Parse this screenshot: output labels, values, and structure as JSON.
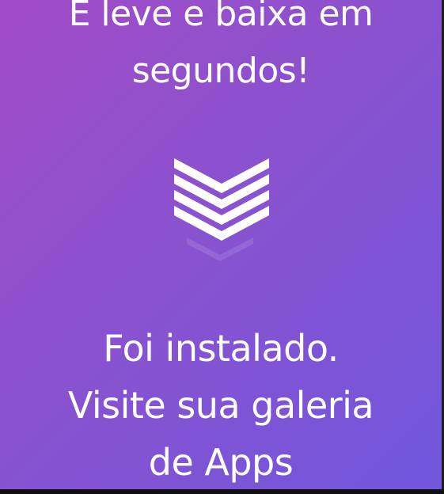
{
  "header": {
    "line1": "É leve e baixa em",
    "line2": "segundos!"
  },
  "status": {
    "line1": "Foi instalado.",
    "line2": "Visite sua galeria",
    "line3": "de Apps"
  },
  "icons": {
    "download": "chevron-stack-down-icon"
  },
  "colors": {
    "gradient_start": "#a24bc6",
    "gradient_end": "#7157dd",
    "text": "#ffffff"
  }
}
